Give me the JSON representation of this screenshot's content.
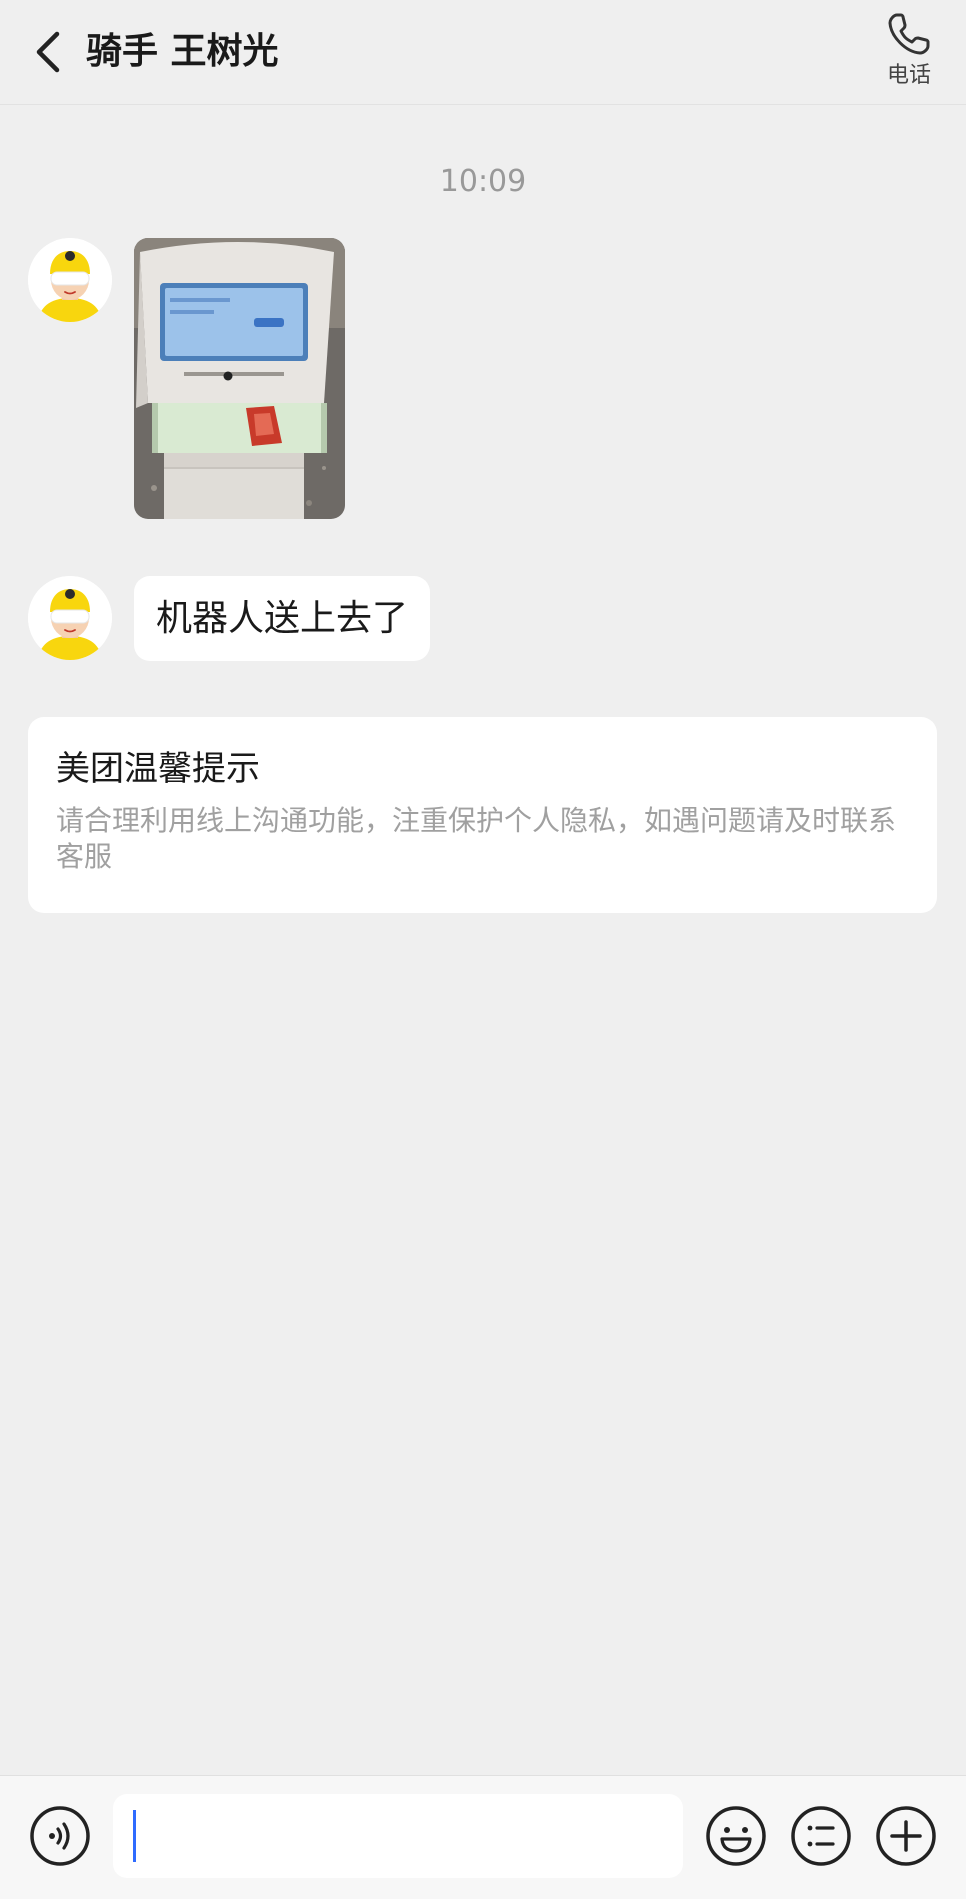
{
  "header": {
    "title": "骑手 王树光",
    "call_label": "电话",
    "icons": {
      "back": "chevron-left-icon",
      "call": "phone-icon"
    }
  },
  "chat": {
    "timestamp": "10:09",
    "messages": [
      {
        "type": "image",
        "sender": "rider",
        "content": "robot delivery photo"
      },
      {
        "type": "text",
        "sender": "rider",
        "text": "机器人送上去了"
      }
    ],
    "tip": {
      "title": "美团温馨提示",
      "body": "请合理利用线上沟通功能，注重保护个人隐私，如遇问题请及时联系客服"
    }
  },
  "input_bar": {
    "value": "",
    "icons": [
      "voice-icon",
      "emoji-icon",
      "quick-reply-icon",
      "add-icon"
    ]
  },
  "colors": {
    "background": "#efefef",
    "bubble": "#ffffff",
    "caret": "#2f6bff",
    "avatar_helmet": "#f8d60e"
  }
}
